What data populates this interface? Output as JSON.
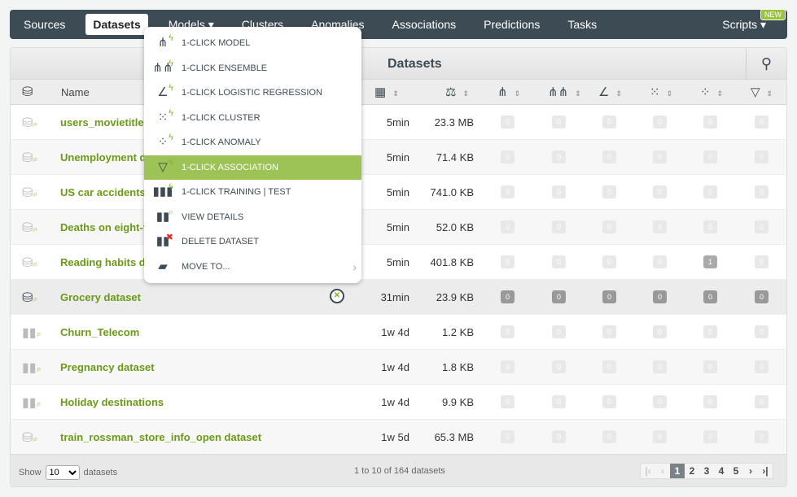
{
  "nav": {
    "items": [
      "Sources",
      "Datasets",
      "Models ▾",
      "Clusters",
      "Anomalies",
      "Associations",
      "Predictions",
      "Tasks"
    ],
    "active": "Datasets",
    "scripts": "Scripts ▾",
    "new_badge": "NEW"
  },
  "panel": {
    "title": "Datasets",
    "search_icon": "search-icon"
  },
  "header": {
    "name": "Name",
    "columns": [
      "age-calendar-icon",
      "size-weight-icon",
      "model-icon",
      "ensemble-icon",
      "logistic-regression-icon",
      "cluster-icon",
      "anomaly-icon",
      "association-icon"
    ]
  },
  "rows": [
    {
      "name": "users_movietitles",
      "age": "5min",
      "size": "23.3 MB",
      "counts": [
        "0",
        "0",
        "0",
        "0",
        "0",
        "0"
      ]
    },
    {
      "name": "Unemployment da",
      "age": "5min",
      "size": "71.4 KB",
      "counts": [
        "0",
        "0",
        "0",
        "0",
        "0",
        "0"
      ]
    },
    {
      "name": "US car accidents c",
      "age": "5min",
      "size": "741.0 KB",
      "counts": [
        "0",
        "0",
        "0",
        "0",
        "0",
        "0"
      ]
    },
    {
      "name": "Deaths on eight-th",
      "age": "5min",
      "size": "52.0 KB",
      "counts": [
        "0",
        "0",
        "0",
        "0",
        "0",
        "0"
      ]
    },
    {
      "name": "Reading habits da",
      "age": "5min",
      "size": "401.8 KB",
      "counts": [
        "0",
        "0",
        "0",
        "0",
        "1",
        "0"
      ]
    },
    {
      "name": "Grocery dataset",
      "age": "31min",
      "size": "23.9 KB",
      "counts": [
        "0",
        "0",
        "0",
        "0",
        "0",
        "0"
      ]
    },
    {
      "name": "Churn_Telecom",
      "age": "1w 4d",
      "size": "1.2 KB",
      "counts": [
        "0",
        "0",
        "0",
        "0",
        "0",
        "0"
      ]
    },
    {
      "name": "Pregnancy dataset",
      "age": "1w 4d",
      "size": "1.8 KB",
      "counts": [
        "0",
        "0",
        "0",
        "0",
        "0",
        "0"
      ]
    },
    {
      "name": "Holiday destinations",
      "age": "1w 4d",
      "size": "9.9 KB",
      "counts": [
        "0",
        "0",
        "0",
        "0",
        "0",
        "0"
      ]
    },
    {
      "name": "train_rossman_store_info_open dataset",
      "age": "1w 5d",
      "size": "65.3 MB",
      "counts": [
        "0",
        "0",
        "0",
        "0",
        "0",
        "0"
      ]
    }
  ],
  "menu": {
    "items": [
      "1-CLICK MODEL",
      "1-CLICK ENSEMBLE",
      "1-CLICK LOGISTIC REGRESSION",
      "1-CLICK CLUSTER",
      "1-CLICK ANOMALY",
      "1-CLICK ASSOCIATION",
      "1-CLICK TRAINING | TEST",
      "VIEW DETAILS",
      "DELETE DATASET",
      "MOVE TO..."
    ],
    "selected": "1-CLICK ASSOCIATION"
  },
  "footer": {
    "show": "Show",
    "page_size": "10",
    "datasets": "datasets",
    "info": "1 to 10 of 164 datasets",
    "pages": [
      "1",
      "2",
      "3",
      "4",
      "5"
    ],
    "current_page": "1"
  },
  "colors": {
    "nav_bg": "#3d4b54",
    "link_green": "#6a9a16",
    "menu_selected": "#9dc356"
  }
}
